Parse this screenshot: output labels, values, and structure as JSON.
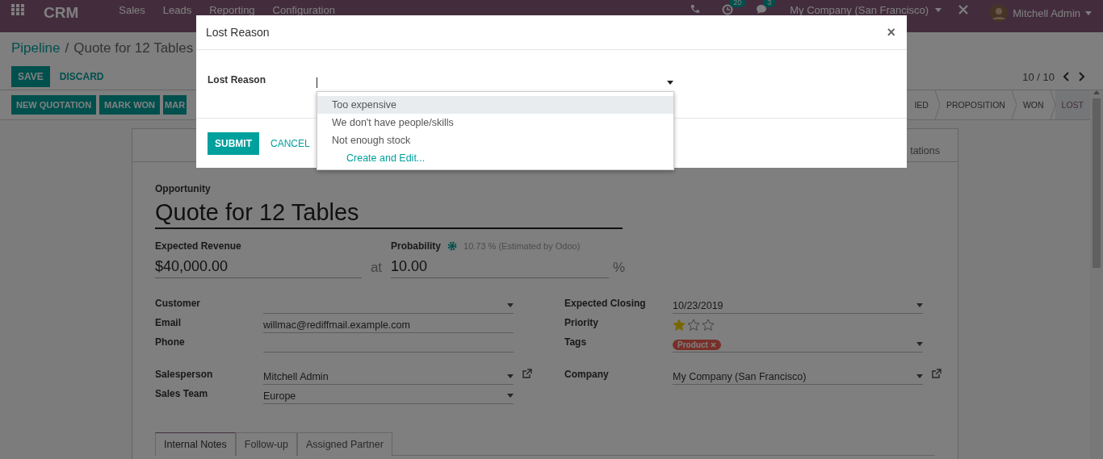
{
  "navbar": {
    "app_name": "CRM",
    "menu": [
      "Sales",
      "Leads",
      "Reporting",
      "Configuration"
    ],
    "activity_count": "20",
    "message_count": "3",
    "company": "My Company (San Francisco)",
    "user": "Mitchell Admin"
  },
  "breadcrumb": {
    "items": [
      "Pipeline",
      "Quote for 12 Tables"
    ],
    "separator": "/"
  },
  "actions": {
    "save": "SAVE",
    "discard": "DISCARD",
    "pager": "10 / 10"
  },
  "header_buttons": [
    "NEW QUOTATION",
    "MARK WON",
    "MAR"
  ],
  "stages": [
    {
      "label": "IED",
      "selected": false
    },
    {
      "label": "PROPOSITION",
      "selected": false
    },
    {
      "label": "WON",
      "selected": false
    },
    {
      "label": "LOST",
      "selected": true
    }
  ],
  "smart_button": "tations",
  "form": {
    "title_label": "Opportunity",
    "title": "Quote for 12 Tables",
    "revenue_label": "Expected Revenue",
    "revenue": "$40,000.00",
    "at": "at",
    "probability_label": "Probability",
    "estimate": "10.73 % (Estimated by Odoo)",
    "probability": "10.00",
    "percent": "%",
    "left": [
      {
        "fields": [
          {
            "label": "Customer",
            "kind": "select"
          },
          {
            "label": "Email",
            "kind": "text",
            "value": "willmac@rediffmail.example.com"
          },
          {
            "label": "Phone",
            "kind": "text"
          }
        ]
      },
      {
        "fields": [
          {
            "label": "Salesperson",
            "kind": "select",
            "value": "Mitchell Admin",
            "external_link": true
          },
          {
            "label": "Sales Team",
            "kind": "select",
            "value": "Europe"
          }
        ]
      }
    ],
    "right": [
      {
        "fields": [
          {
            "label": "Expected Closing",
            "kind": "select",
            "value": "10/23/2019"
          },
          {
            "label": "Priority",
            "kind": "stars",
            "stars": 1
          },
          {
            "label": "Tags",
            "kind": "tags",
            "tags": [
              {
                "label": "Product"
              }
            ]
          }
        ]
      },
      {
        "fields": [
          {
            "label": "Company",
            "kind": "select",
            "value": "My Company (San Francisco)",
            "external_link": true
          }
        ]
      }
    ],
    "tabs": [
      {
        "label": "Internal Notes",
        "selected": true
      },
      {
        "label": "Follow-up",
        "selected": false
      },
      {
        "label": "Assigned Partner",
        "selected": false
      }
    ]
  },
  "dialog": {
    "title": "Lost Reason",
    "close": "×",
    "field_label": "Lost Reason",
    "options": [
      {
        "label": "Too expensive",
        "selected": true
      },
      {
        "label": "We don't have people/skills",
        "selected": false
      },
      {
        "label": "Not enough stock",
        "selected": false
      }
    ],
    "create": "Create and Edit...",
    "submit": "SUBMIT",
    "cancel": "CANCEL"
  }
}
